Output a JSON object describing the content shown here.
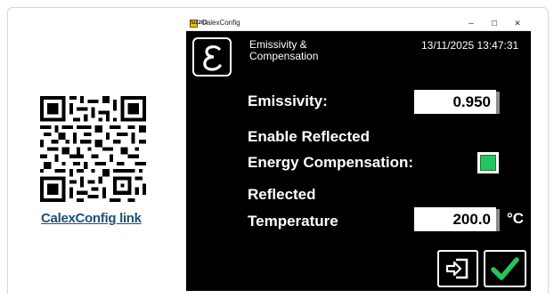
{
  "qr": {
    "link_text": "CalexConfig link"
  },
  "window": {
    "title": "CalexConfig",
    "app_icon": "app-icon",
    "controls": {
      "minimize": "–",
      "maximize": "☐",
      "close": "✕"
    }
  },
  "header": {
    "logo_glyph": "ε",
    "title_line1": "Emissivity &",
    "title_line2": "Compensation",
    "datetime": "13/11/2025 13:47:31"
  },
  "emissivity": {
    "label": "Emissivity:",
    "value": "0.950"
  },
  "reflected_comp": {
    "label_line1": "Enable Reflected",
    "label_line2": "Energy Compensation:",
    "enabled": true
  },
  "reflected_temp": {
    "label_line1": "Reflected",
    "label_line2": "Temperature",
    "value": "200.0",
    "unit": "°C"
  },
  "buttons": {
    "exit_icon": "exit-icon",
    "ok_icon": "check-icon"
  },
  "colors": {
    "accent_green": "#22c55e",
    "link": "#1f4f7a",
    "window_bg": "#000000"
  }
}
